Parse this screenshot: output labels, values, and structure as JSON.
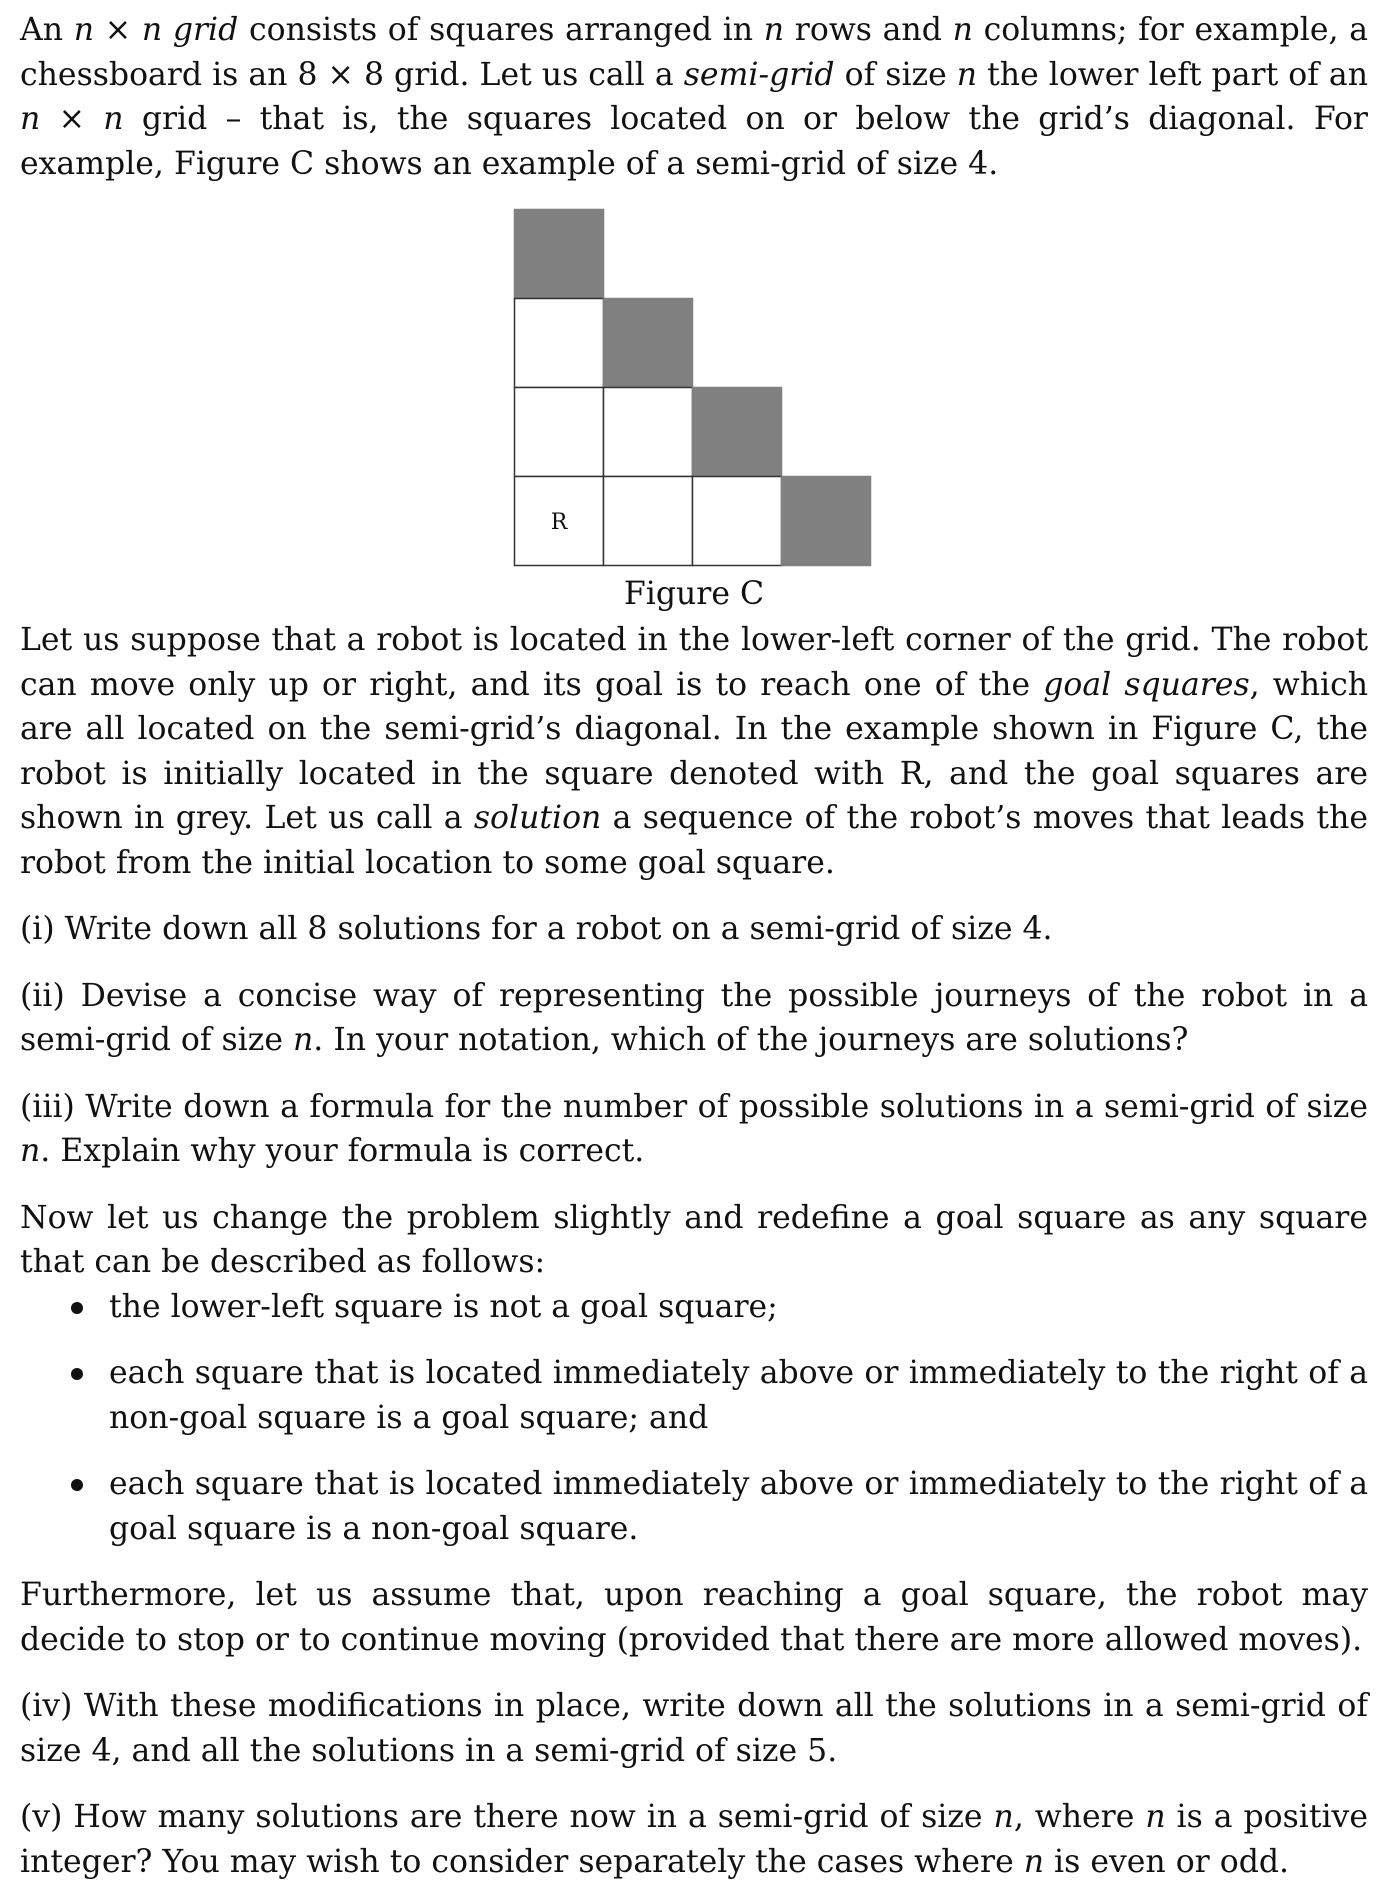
{
  "intro_paragraph": {
    "s1": "An ",
    "s2": "n × n grid",
    "s3": " consists of squares arranged in ",
    "s4": "n",
    "s5": " rows and ",
    "s6": "n",
    "s7": " columns; for example, a chessboard is an 8 × 8 grid. Let us call a ",
    "s8": "semi-grid",
    "s9": " of size ",
    "s10": "n",
    "s11": " the lower left part of an ",
    "s12": "n × n",
    "s13": " grid – that is, the squares located on or below the grid’s diagonal. For example, Figure C shows an example of a semi-grid of size 4."
  },
  "figure": {
    "caption": "Figure C",
    "robot_label": "R",
    "size": 4,
    "goal_color": "#808080",
    "cell_border_color": "#333333"
  },
  "robot_paragraph": {
    "s1": "Let us suppose that a robot is located in the lower-left corner of the grid. The robot can move only up or right, and its goal is to reach one of the ",
    "s2": "goal squares",
    "s3": ", which are all located on the semi-grid’s diagonal. In the example shown in Figure C, the robot is initially located in the square denoted with R, and the goal squares are shown in grey. Let us call a ",
    "s4": "solution",
    "s5": " a sequence of the robot’s moves that leads the robot from the initial location to some goal square."
  },
  "q1": {
    "text": "(i) Write down all 8 solutions for a robot on a semi-grid of size 4."
  },
  "q2": {
    "s1": "(ii) Devise a concise way of representing the possible journeys of the robot in a semi-grid of size ",
    "s2": "n",
    "s3": ". In your notation, which of the journeys are solutions?"
  },
  "q3": {
    "s1": "(iii) Write down a formula for the number of possible solutions in a semi-grid of size ",
    "s2": "n",
    "s3": ". Explain why your formula is correct."
  },
  "change_paragraph": {
    "text": "Now let us change the problem slightly and redefine a goal square as any square that can be described as follows:"
  },
  "bullets": [
    {
      "text": "the lower-left square is not a goal square;"
    },
    {
      "text": "each square that is located immediately above or immediately to the right of a non-goal square is a goal square; and"
    },
    {
      "text": "each square that is located immediately above or immediately to the right of a goal square is a non-goal square."
    }
  ],
  "furthermore_paragraph": {
    "text": "Furthermore, let us assume that, upon reaching a goal square, the robot may decide to stop or to continue moving (provided that there are more allowed moves)."
  },
  "q4": {
    "text": "(iv) With these modifications in place, write down all the solutions in a semi-grid of size 4, and all the solutions in a semi-grid of size 5."
  },
  "q5": {
    "s1": "(v) How many solutions are there now in a semi-grid of size ",
    "s2": "n",
    "s3": ", where ",
    "s4": "n",
    "s5": " is a positive integer? You may wish to consider separately the cases where ",
    "s6": "n",
    "s7": " is even or odd."
  }
}
